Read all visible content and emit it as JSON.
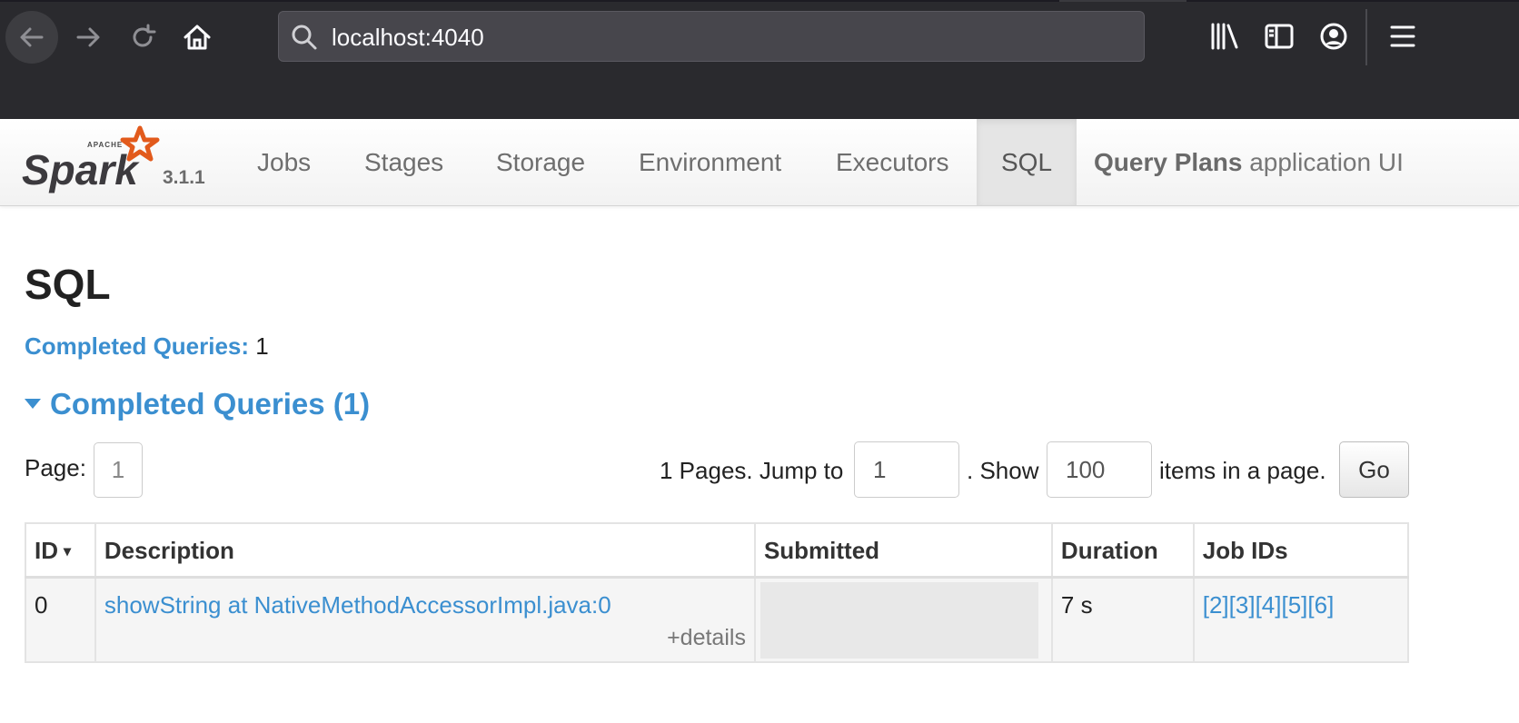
{
  "browser": {
    "url": "localhost:4040"
  },
  "navbar": {
    "version": "3.1.1",
    "items": [
      {
        "label": "Jobs"
      },
      {
        "label": "Stages"
      },
      {
        "label": "Storage"
      },
      {
        "label": "Environment"
      },
      {
        "label": "Executors"
      },
      {
        "label": "SQL",
        "active": true
      }
    ],
    "app_title_bold": "Query Plans",
    "app_title_rest": "application UI"
  },
  "page": {
    "title": "SQL",
    "summary_label": "Completed Queries:",
    "summary_value": "1",
    "section_title": "Completed Queries (1)"
  },
  "pagination": {
    "page_label": "Page:",
    "current_page": "1",
    "pages_text": "1 Pages. Jump to",
    "jump_value": "1",
    "show_text": ". Show",
    "show_value": "100",
    "items_text": "items in a page.",
    "go_label": "Go"
  },
  "table": {
    "columns": [
      "ID",
      "Description",
      "Submitted",
      "Duration",
      "Job IDs"
    ],
    "sort_indicator": "▾",
    "rows": [
      {
        "id": "0",
        "description": "showString at NativeMethodAccessorImpl.java:0",
        "details": "+details",
        "submitted": "",
        "duration": "7 s",
        "job_ids": [
          "[2]",
          "[3]",
          "[4]",
          "[5]",
          "[6]"
        ]
      }
    ]
  },
  "colors": {
    "link": "#3b8fd0",
    "chrome_bg": "#2a2a2e"
  }
}
